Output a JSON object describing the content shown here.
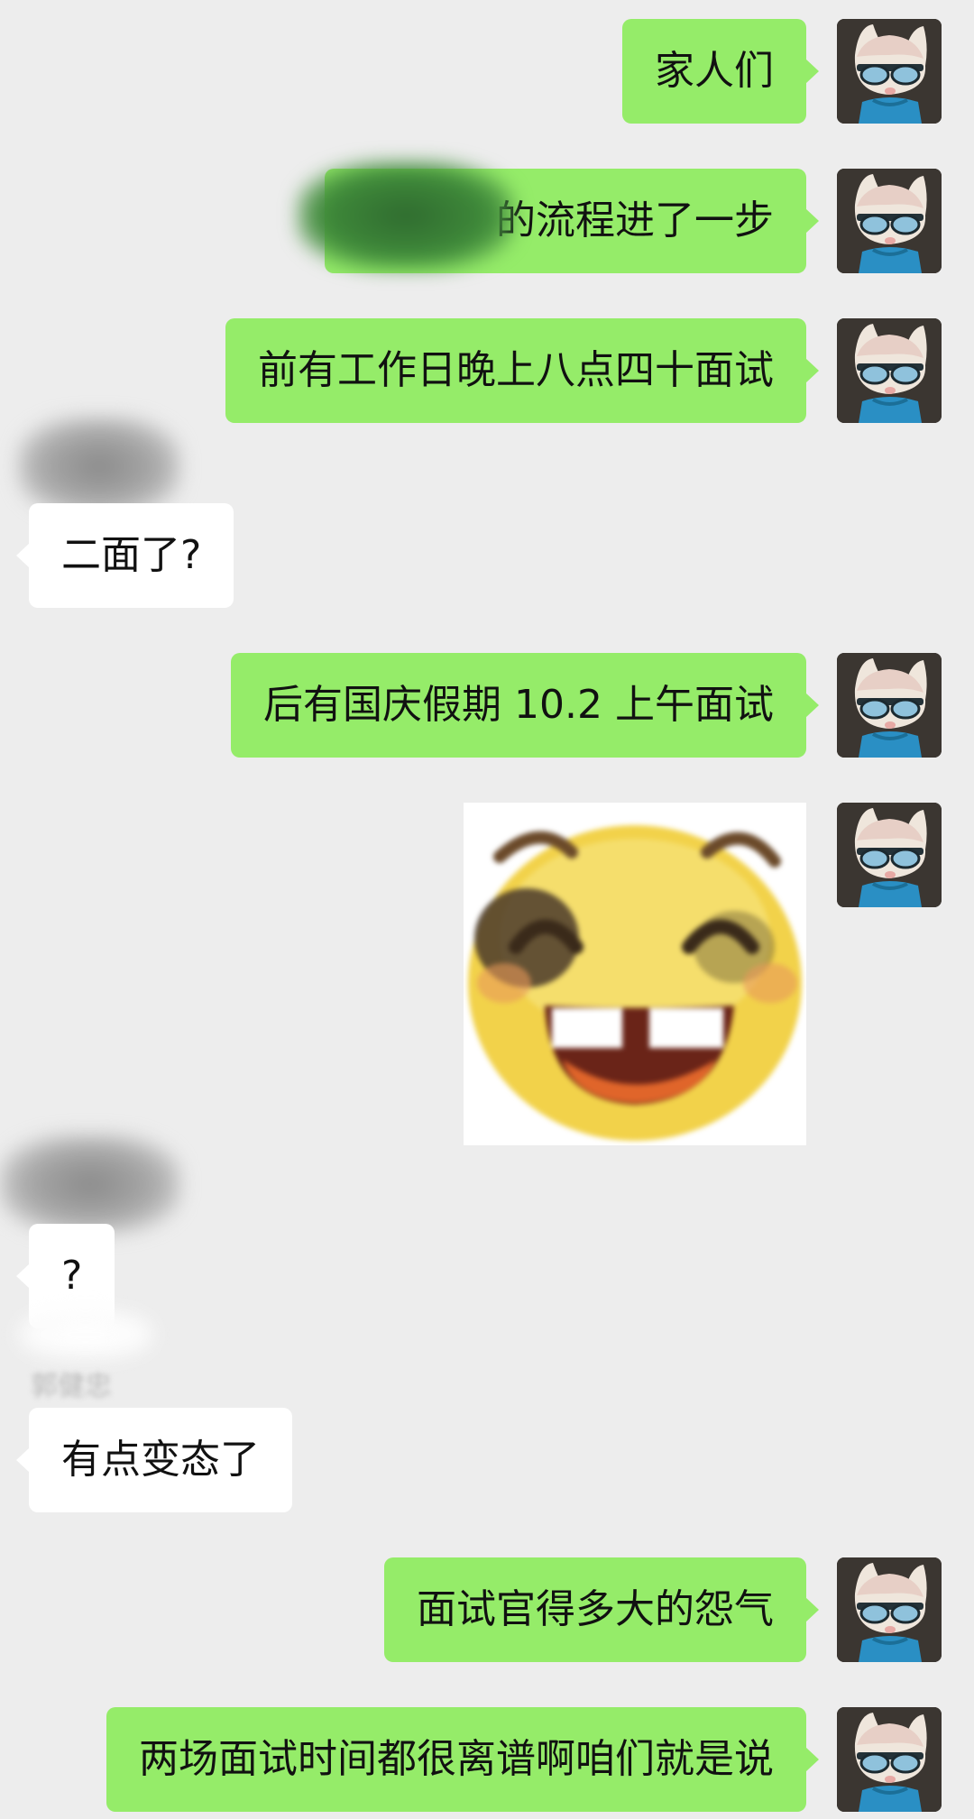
{
  "chat": {
    "self_avatar_icon": "cat-in-sunglasses-avatar",
    "bubble_colors": {
      "outgoing": "#95ec69",
      "incoming": "#ffffff",
      "background": "#ededed"
    },
    "messages": [
      {
        "direction": "outgoing",
        "text": "家人们"
      },
      {
        "direction": "outgoing",
        "text": "的流程进了一步"
      },
      {
        "direction": "outgoing",
        "text": "前有工作日晚上八点四十面试"
      },
      {
        "direction": "incoming",
        "text": "二面了?"
      },
      {
        "direction": "outgoing",
        "text": "后有国庆假期 10.2 上午面试"
      },
      {
        "direction": "outgoing",
        "type": "sticker",
        "sticker_icon": "grinning-bruised-face-emoji"
      },
      {
        "direction": "incoming",
        "text": "?"
      },
      {
        "direction": "incoming",
        "sender": "郭健忠",
        "text": "有点变态了"
      },
      {
        "direction": "outgoing",
        "text": "面试官得多大的怨气"
      },
      {
        "direction": "outgoing",
        "text": "两场面试时间都很离谱啊咱们就是说"
      }
    ]
  }
}
